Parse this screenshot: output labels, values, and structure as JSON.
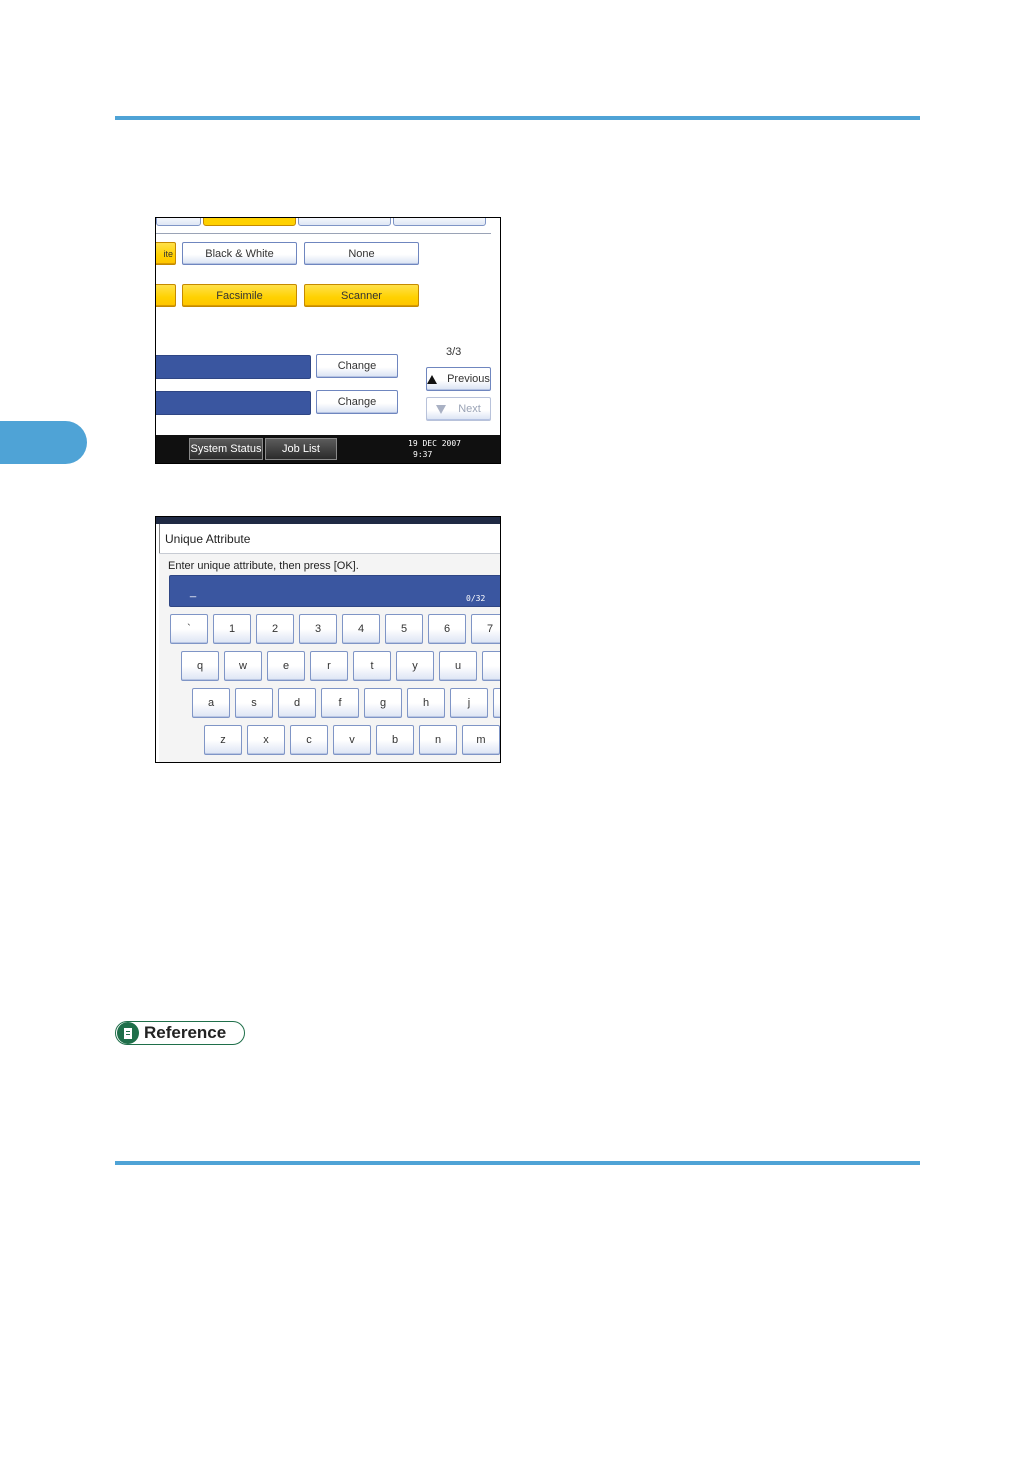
{
  "screen1": {
    "partial_left_label_1": "ite",
    "color_options": [
      "Black & White",
      "None"
    ],
    "partial_left_label_2": "",
    "function_options": [
      "Facsimile",
      "Scanner"
    ],
    "change_buttons": [
      "Change",
      "Change"
    ],
    "page_indicator": "3/3",
    "previous_label": "Previous",
    "next_label": "Next",
    "status_bar": {
      "system_status": "System Status",
      "job_list": "Job List",
      "date": "19  DEC    2007",
      "time": "9:37"
    }
  },
  "screen2": {
    "dialog_title": "Unique Attribute",
    "instruction": "Enter unique attribute, then press [OK].",
    "input_value": "_",
    "char_counter": "0/32",
    "keyboard": {
      "row1": [
        "`",
        "1",
        "2",
        "3",
        "4",
        "5",
        "6",
        "7"
      ],
      "row2": [
        "q",
        "w",
        "e",
        "r",
        "t",
        "y",
        "u",
        ""
      ],
      "row3": [
        "a",
        "s",
        "d",
        "f",
        "g",
        "h",
        "j",
        ""
      ],
      "row4": [
        "z",
        "x",
        "c",
        "v",
        "b",
        "n",
        "m"
      ]
    }
  },
  "reference": {
    "label": "Reference",
    "icon": "reference-book-icon"
  },
  "colors": {
    "rule": "#4fa3d6",
    "selected_button": "#ffd100",
    "input_bar": "#3a56a0",
    "reference_badge": "#1f6f4a"
  }
}
